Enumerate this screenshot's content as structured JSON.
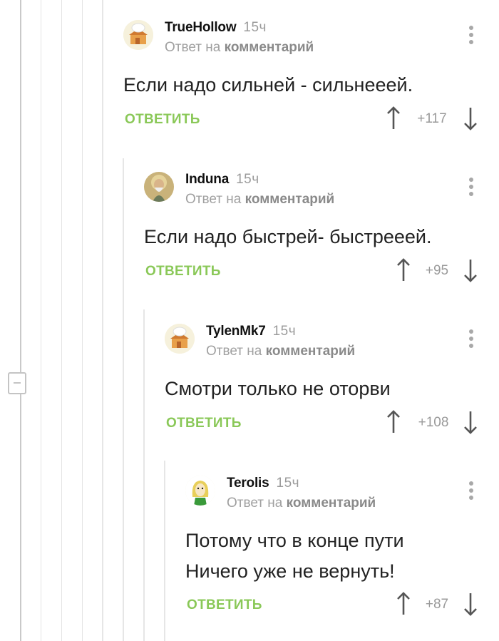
{
  "comments": [
    {
      "author": "TrueHollow",
      "time": "15ч",
      "reply_prefix": "Ответ на",
      "reply_target": "комментарий",
      "lines": [
        "Если надо сильней - сильнееей."
      ],
      "reply_label": "ОТВЕТИТЬ",
      "score": "+117",
      "avatar": "chef-house-icon"
    },
    {
      "author": "Induna",
      "time": "15ч",
      "reply_prefix": "Ответ на",
      "reply_target": "комментарий",
      "lines": [
        "Если надо быстрей- быстрееей."
      ],
      "reply_label": "ОТВЕТИТЬ",
      "score": "+95",
      "avatar": "icon-portrait"
    },
    {
      "author": "TylenMk7",
      "time": "15ч",
      "reply_prefix": "Ответ на",
      "reply_target": "комментарий",
      "lines": [
        "Смотри только не оторви"
      ],
      "reply_label": "ОТВЕТИТЬ",
      "score": "+108",
      "avatar": "chef-house-icon"
    },
    {
      "author": "Terolis",
      "time": "15ч",
      "reply_prefix": "Ответ на",
      "reply_target": "комментарий",
      "lines": [
        "Потому что в конце пути",
        "Ничего уже не вернуть!"
      ],
      "reply_label": "ОТВЕТИТЬ",
      "score": "+87",
      "avatar": "cartoon-girl-icon"
    }
  ],
  "colors": {
    "accent_green": "#8ac858",
    "thread_line": "#e4e4e4",
    "muted_text": "#a0a0a0"
  }
}
